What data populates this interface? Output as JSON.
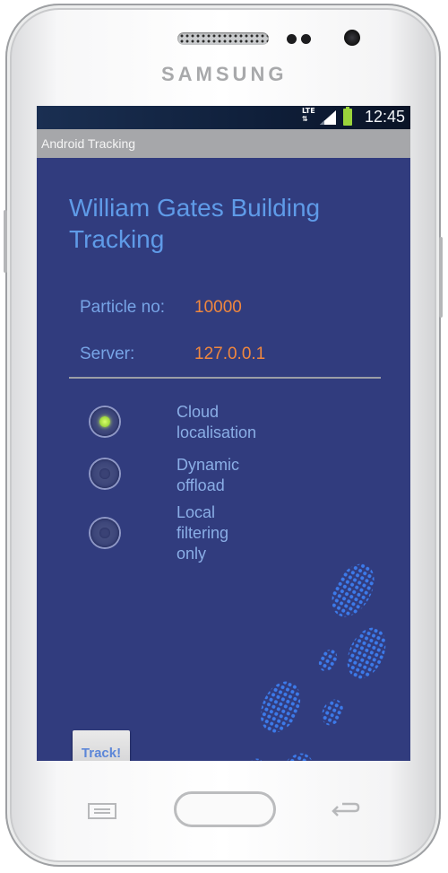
{
  "device": {
    "brand": "SAMSUNG"
  },
  "statusbar": {
    "network": "LTE",
    "time": "12:45",
    "battery_color": "#9bd43b"
  },
  "app": {
    "title": "Android Tracking",
    "heading": "William Gates Building Tracking",
    "particle_label": "Particle no:",
    "particle_value": "10000",
    "server_label": "Server:",
    "server_value": "127.0.0.1",
    "options": [
      {
        "label_lines": [
          "Cloud",
          "localisation"
        ],
        "selected": true
      },
      {
        "label_lines": [
          "Dynamic",
          "offload"
        ],
        "selected": false
      },
      {
        "label_lines": [
          "Local",
          "filtering",
          "only"
        ],
        "selected": false
      }
    ],
    "track_button": "Track!"
  },
  "colors": {
    "app_background": "#313c7e",
    "heading": "#5f9be8",
    "label": "#77a4e6",
    "value": "#f0873e",
    "footprint": "#3d7ef0"
  },
  "icons": {
    "menu_key": "menu-icon",
    "back_key": "back-arrow-icon",
    "decoration": "footprints-icon"
  }
}
